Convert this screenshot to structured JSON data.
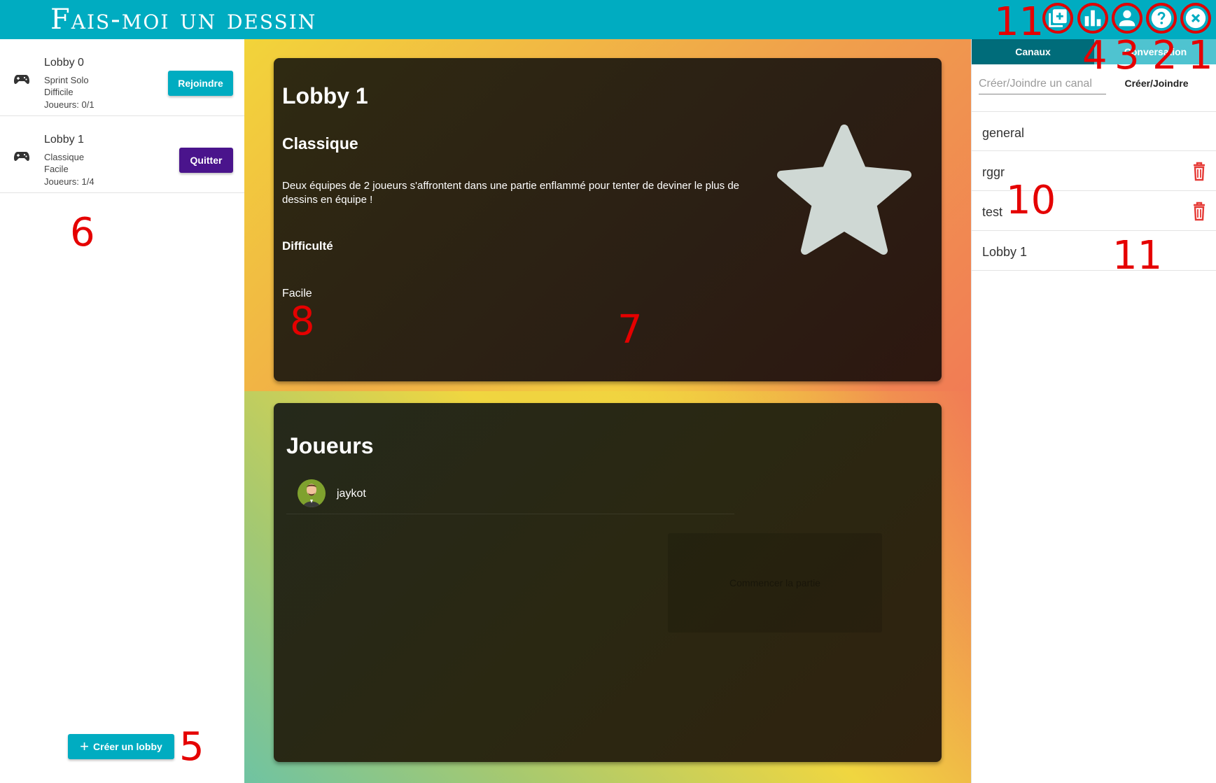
{
  "app": {
    "title": "Fais-moi un dessin"
  },
  "header_icons": [
    {
      "name": "add-icon"
    },
    {
      "name": "bar-chart-icon"
    },
    {
      "name": "account-icon"
    },
    {
      "name": "help-icon"
    },
    {
      "name": "close-icon"
    }
  ],
  "annotations": {
    "top_add": "11",
    "top_stats": "4",
    "top_profile": "3",
    "top_help": "2",
    "top_close": "1",
    "create_lobby": "5",
    "lobby_list": "6",
    "lobby_card": "7",
    "difficulty": "8",
    "channel_delete": "10",
    "channel_lobby": "11"
  },
  "lobbies": [
    {
      "name": "Lobby 0",
      "mode": "Sprint Solo",
      "difficulty": "Difficile",
      "players": "Joueurs: 0/1",
      "action": "Rejoindre"
    },
    {
      "name": "Lobby 1",
      "mode": "Classique",
      "difficulty": "Facile",
      "players": "Joueurs: 1/4",
      "action": "Quitter"
    }
  ],
  "create_lobby": {
    "label": "Créer un lobby"
  },
  "lobby_details": {
    "title": "Lobby 1",
    "mode": "Classique",
    "description": "Deux équipes de 2 joueurs s'affrontent dans une partie enflammé pour tenter de deviner le plus de dessins en équipe !",
    "difficulty_label": "Difficulté",
    "difficulty_value": "Facile"
  },
  "players_card": {
    "title": "Joueurs",
    "players": [
      {
        "name": "jaykot"
      }
    ],
    "start_label": "Commencer la partie"
  },
  "chat": {
    "tabs": [
      {
        "label": "Canaux"
      },
      {
        "label": "Conversation"
      }
    ],
    "channel_input_placeholder": "Créer/Joindre un canal",
    "join_label": "Créer/Joindre",
    "channels": [
      {
        "name": "general"
      },
      {
        "name": "rggr"
      },
      {
        "name": "test"
      },
      {
        "name": "Lobby 1"
      }
    ]
  },
  "colors": {
    "primary": "#00acc1",
    "quit": "#4a148c",
    "tab_active": "#006c7a",
    "tab_inactive": "#4fc3d0",
    "danger": "#e53935",
    "annotation": "#e50000"
  }
}
